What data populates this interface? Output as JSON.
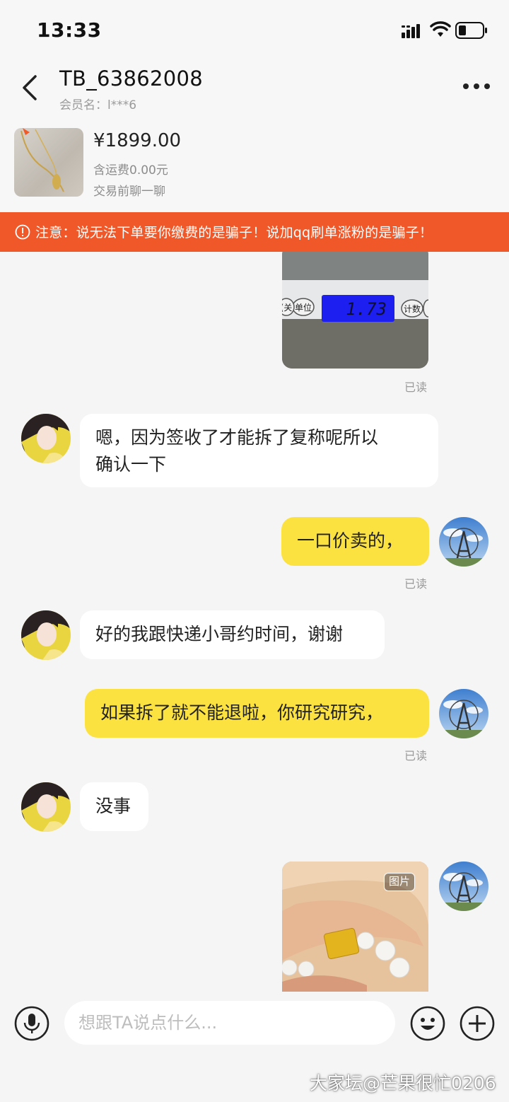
{
  "status_bar": {
    "time": "13:33"
  },
  "header": {
    "title": "TB_63862008",
    "subtitle": "会员名：l***6"
  },
  "product": {
    "price": "¥1899.00",
    "shipping": "含运费0.00元",
    "note": "交易前聊一聊"
  },
  "warning": {
    "text": "注意：说无法下单要你缴费的是骗子！说加qq刷单涨粉的是骗子！",
    "color": "#f0582a"
  },
  "messages": [
    {
      "side": "out",
      "type": "image",
      "scale_reading": "1.73",
      "scale_left_label": "(关",
      "scale_unit_label": "单位",
      "scale_count_label": "计数",
      "read": "已读"
    },
    {
      "side": "in",
      "type": "text",
      "lines": [
        "嗯，因为签收了才能拆了复称呢所以",
        "确认一下"
      ]
    },
    {
      "side": "out",
      "type": "text",
      "text": "一口价卖的，",
      "read": "已读"
    },
    {
      "side": "in",
      "type": "text",
      "text": "好的我跟快递小哥约时间，谢谢"
    },
    {
      "side": "out",
      "type": "text",
      "text": "如果拆了就不能退啦，你研究研究，",
      "read": "已读"
    },
    {
      "side": "in",
      "type": "text",
      "text": "没事"
    },
    {
      "side": "out",
      "type": "image",
      "badge": "图片"
    }
  ],
  "input": {
    "placeholder": "想跟TA说点什么..."
  },
  "icons": [
    "signal-icon",
    "wifi-icon",
    "battery-icon",
    "back-icon",
    "more-icon",
    "warning-icon",
    "voice-icon",
    "emoji-icon",
    "plus-icon"
  ],
  "colors": {
    "outgoing_bubble": "#fbe241",
    "incoming_bubble": "#ffffff",
    "background": "#f5f5f5"
  },
  "watermark": "大家坛@芒果很忙0206"
}
